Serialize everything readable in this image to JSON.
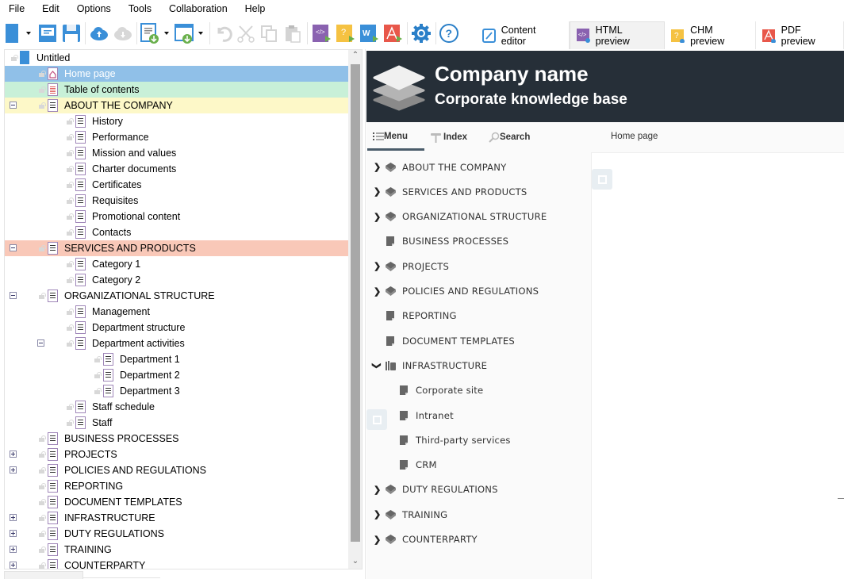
{
  "menubar": {
    "items": [
      "File",
      "Edit",
      "Options",
      "Tools",
      "Collaboration",
      "Help"
    ]
  },
  "toolbar": {
    "buttons": [
      {
        "name": "new-project",
        "icon": "blue-book-icon",
        "has_dropdown": true
      },
      {
        "name": "open",
        "icon": "open-folder-icon"
      },
      {
        "name": "save",
        "icon": "save-icon"
      },
      {
        "name": "upload-cloud",
        "icon": "cloud-upload-icon"
      },
      {
        "name": "download-cloud",
        "icon": "cloud-download-icon",
        "disabled": true
      },
      {
        "name": "import-document",
        "icon": "import-document-icon",
        "has_dropdown": true
      },
      {
        "name": "import-web",
        "icon": "import-web-icon",
        "has_dropdown": true
      },
      {
        "name": "undo",
        "icon": "undo-icon",
        "disabled": true
      },
      {
        "name": "cut",
        "icon": "cut-icon",
        "disabled": true
      },
      {
        "name": "copy",
        "icon": "copy-icon",
        "disabled": true
      },
      {
        "name": "paste",
        "icon": "paste-icon",
        "disabled": true
      },
      {
        "name": "publish-html",
        "icon": "html-publish-icon",
        "color": "#8a62b0"
      },
      {
        "name": "publish-chm",
        "icon": "chm-publish-icon",
        "color": "#f5c242"
      },
      {
        "name": "publish-word",
        "icon": "word-publish-icon",
        "color": "#3a8fd8"
      },
      {
        "name": "publish-pdf",
        "icon": "pdf-publish-icon",
        "color": "#e8574a"
      },
      {
        "name": "settings",
        "icon": "gear-icon",
        "color": "#2a7fc8"
      },
      {
        "name": "help",
        "icon": "help-icon",
        "color": "#2a7fc8"
      }
    ]
  },
  "tabs": [
    {
      "label": "Content editor",
      "icon": "content-editor-icon",
      "active": false
    },
    {
      "label": "HTML preview",
      "icon": "html-preview-icon",
      "active": true
    },
    {
      "label": "CHM preview",
      "icon": "chm-preview-icon",
      "active": false
    },
    {
      "label": "PDF preview",
      "icon": "pdf-preview-icon",
      "active": false
    }
  ],
  "tree": {
    "root": "Untitled",
    "items": [
      {
        "label": "Home page",
        "level": 1,
        "type": "home",
        "highlight": "#90c0e8",
        "selected": true
      },
      {
        "label": "Table of contents",
        "level": 1,
        "type": "toc",
        "highlight": "#c8f0d8"
      },
      {
        "label": "ABOUT THE COMPANY",
        "level": 1,
        "expander": "minus",
        "highlight": "#fdf8c8"
      },
      {
        "label": "History",
        "level": 2
      },
      {
        "label": "Performance",
        "level": 2
      },
      {
        "label": "Mission and values",
        "level": 2
      },
      {
        "label": "Charter documents",
        "level": 2
      },
      {
        "label": "Certificates",
        "level": 2
      },
      {
        "label": "Requisites",
        "level": 2
      },
      {
        "label": "Promotional content",
        "level": 2
      },
      {
        "label": "Contacts",
        "level": 2
      },
      {
        "label": "SERVICES AND PRODUCTS",
        "level": 1,
        "expander": "minus",
        "highlight": "#f9c8b8"
      },
      {
        "label": "Category 1",
        "level": 2
      },
      {
        "label": "Category 2",
        "level": 2
      },
      {
        "label": "ORGANIZATIONAL STRUCTURE",
        "level": 1,
        "expander": "minus"
      },
      {
        "label": "Management",
        "level": 2
      },
      {
        "label": "Department structure",
        "level": 2
      },
      {
        "label": "Department activities",
        "level": 2,
        "expander": "minus"
      },
      {
        "label": "Department 1",
        "level": 3
      },
      {
        "label": "Department 2",
        "level": 3
      },
      {
        "label": "Department 3",
        "level": 3
      },
      {
        "label": "Staff schedule",
        "level": 2
      },
      {
        "label": "Staff",
        "level": 2
      },
      {
        "label": "BUSINESS PROCESSES",
        "level": 1
      },
      {
        "label": "PROJECTS",
        "level": 1,
        "expander": "plus"
      },
      {
        "label": "POLICIES AND REGULATIONS",
        "level": 1,
        "expander": "plus"
      },
      {
        "label": "REPORTING",
        "level": 1
      },
      {
        "label": "DOCUMENT TEMPLATES",
        "level": 1
      },
      {
        "label": "INFRASTRUCTURE",
        "level": 1,
        "expander": "plus"
      },
      {
        "label": "DUTY REGULATIONS",
        "level": 1,
        "expander": "plus"
      },
      {
        "label": "TRAINING",
        "level": 1,
        "expander": "plus"
      },
      {
        "label": "COUNTERPARTY",
        "level": 1,
        "expander": "plus"
      }
    ]
  },
  "preview": {
    "header": {
      "title": "Company name",
      "subtitle": "Corporate knowledge base",
      "bg_color": "#262f38"
    },
    "nav": {
      "menu_label": "Menu",
      "index_label": "Index",
      "search_label": "Search",
      "breadcrumb": "Home page"
    },
    "menu": [
      {
        "label": "ABOUT THE COMPANY",
        "chevron": "right",
        "icon": "book-icon"
      },
      {
        "label": "SERVICES AND PRODUCTS",
        "chevron": "right",
        "icon": "book-icon"
      },
      {
        "label": "ORGANIZATIONAL STRUCTURE",
        "chevron": "right",
        "icon": "book-icon"
      },
      {
        "label": "BUSINESS PROCESSES",
        "chevron": "",
        "icon": "page-icon"
      },
      {
        "label": "PROJECTS",
        "chevron": "right",
        "icon": "book-icon"
      },
      {
        "label": "POLICIES AND REGULATIONS",
        "chevron": "right",
        "icon": "book-icon"
      },
      {
        "label": "REPORTING",
        "chevron": "",
        "icon": "page-icon"
      },
      {
        "label": "DOCUMENT TEMPLATES",
        "chevron": "",
        "icon": "page-icon"
      },
      {
        "label": "INFRASTRUCTURE",
        "chevron": "down",
        "icon": "open-book-icon"
      },
      {
        "label": "Corporate site",
        "chevron": "",
        "icon": "page-icon",
        "child": true
      },
      {
        "label": "Intranet",
        "chevron": "",
        "icon": "page-icon",
        "child": true
      },
      {
        "label": "Third-party services",
        "chevron": "",
        "icon": "page-icon",
        "child": true
      },
      {
        "label": "CRM",
        "chevron": "",
        "icon": "page-icon",
        "child": true
      },
      {
        "label": "DUTY REGULATIONS",
        "chevron": "right",
        "icon": "book-icon"
      },
      {
        "label": "TRAINING",
        "chevron": "right",
        "icon": "book-icon"
      },
      {
        "label": "COUNTERPARTY",
        "chevron": "right",
        "icon": "book-icon"
      }
    ]
  }
}
